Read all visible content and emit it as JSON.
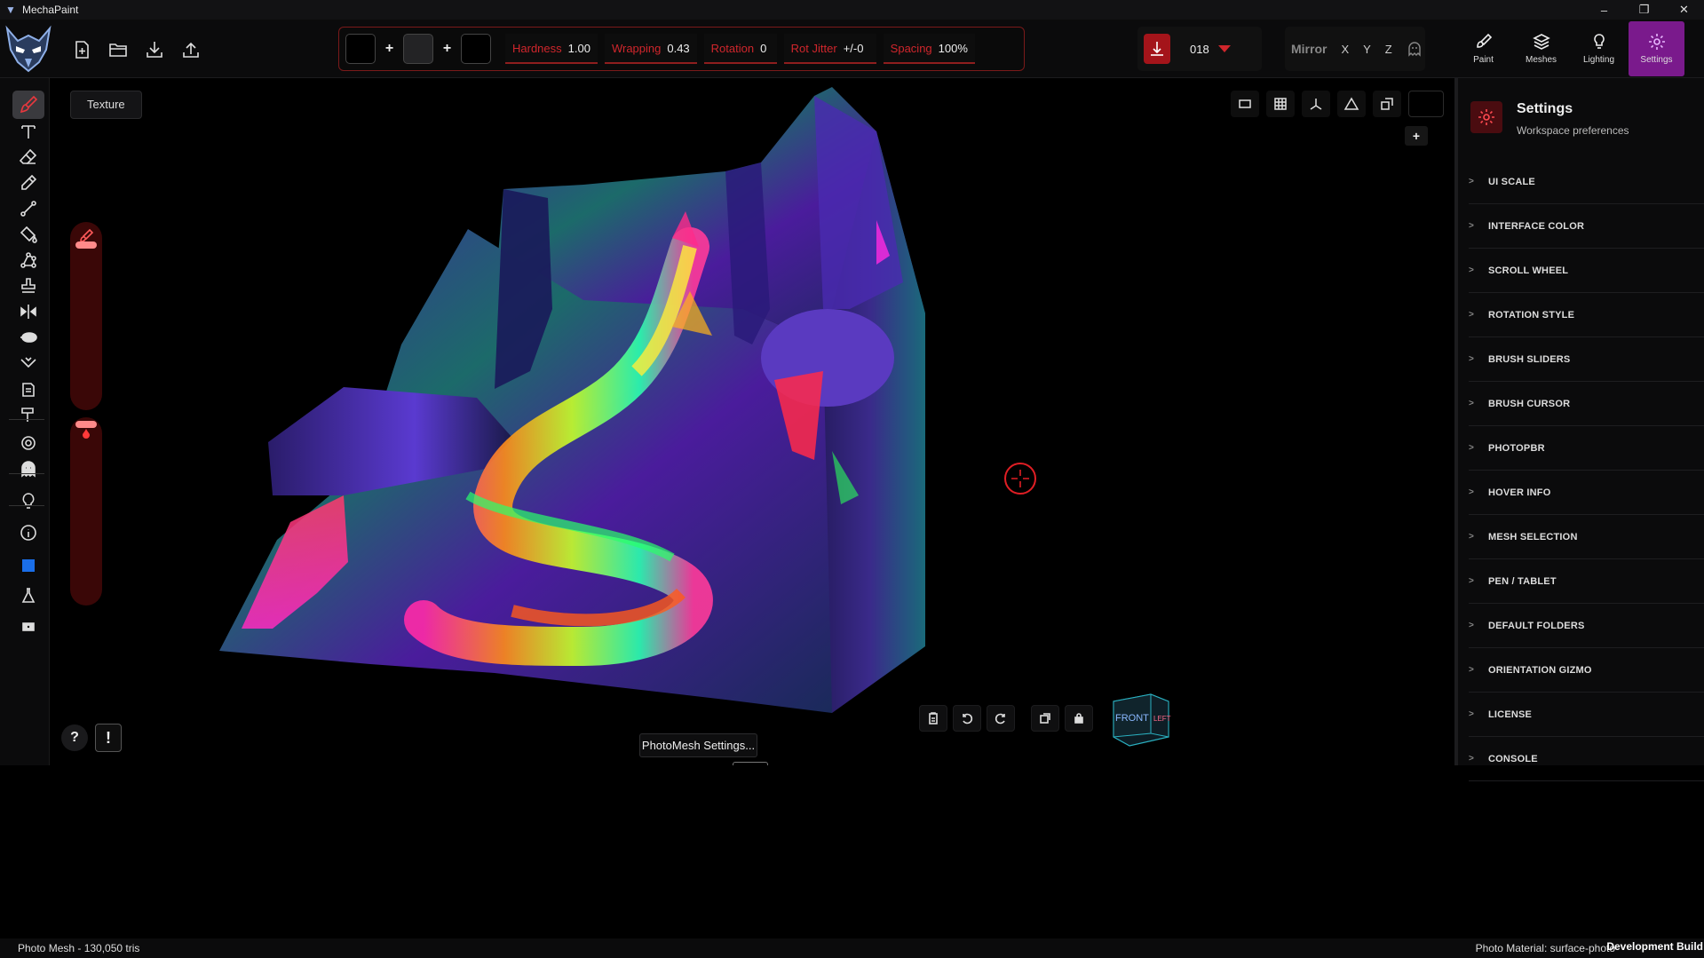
{
  "app": {
    "title": "MechaPaint"
  },
  "window_controls": {
    "minimize": "–",
    "maximize": "❐",
    "close": "✕"
  },
  "brush": {
    "params": [
      {
        "label": "Hardness",
        "value": "1.00"
      },
      {
        "label": "Wrapping",
        "value": "0.43"
      },
      {
        "label": "Rotation",
        "value": "0"
      },
      {
        "label": "Rot Jitter",
        "value": "+/-0"
      },
      {
        "label": "Spacing",
        "value": "100%"
      }
    ],
    "plus": "+"
  },
  "preset": {
    "number": "018"
  },
  "mirror": {
    "label": "Mirror",
    "x": "X",
    "y": "Y",
    "z": "Z"
  },
  "tabs": [
    {
      "label": "Paint",
      "icon": "brush-icon"
    },
    {
      "label": "Meshes",
      "icon": "layers-icon"
    },
    {
      "label": "Lighting",
      "icon": "bulb-icon"
    },
    {
      "label": "Settings",
      "icon": "gear-icon",
      "active": true
    }
  ],
  "viewport": {
    "texture_label": "Texture",
    "add": "+",
    "help": "?",
    "alert": "!",
    "photomesh_button": "PhotoMesh Settings...",
    "gizmo": {
      "front": "FRONT",
      "left": "LEFT"
    }
  },
  "settings": {
    "title": "Settings",
    "subtitle": "Workspace preferences",
    "chevron": ">",
    "items": [
      "UI SCALE",
      "INTERFACE COLOR",
      "SCROLL WHEEL",
      "ROTATION STYLE",
      "BRUSH SLIDERS",
      "BRUSH CURSOR",
      "PHOTOPBR",
      "HOVER INFO",
      "MESH SELECTION",
      "PEN / TABLET",
      "DEFAULT FOLDERS",
      "ORIENTATION GIZMO",
      "LICENSE",
      "CONSOLE"
    ]
  },
  "status": {
    "left": "Photo Mesh  -  130,050 tris",
    "right": "Photo Material: surface-photo",
    "dev": "Development Build"
  },
  "colors": {
    "accent": "#d0262c",
    "active_tab": "#7a1a8c",
    "panel": "#0b0b0c"
  }
}
